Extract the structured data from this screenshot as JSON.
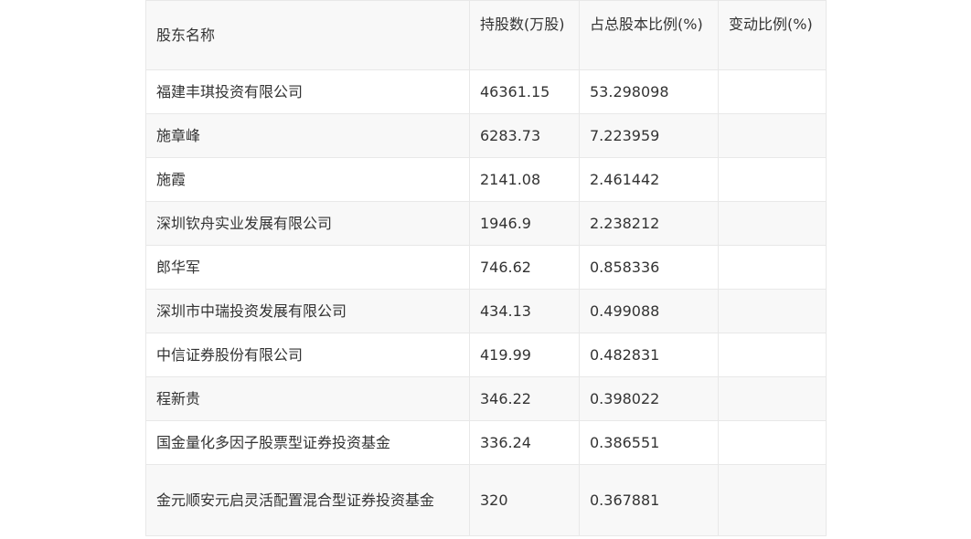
{
  "table": {
    "headers": [
      "股东名称",
      "持股数(万股)",
      "占总股本比例(%)",
      "变动比例(%)"
    ],
    "rows": [
      [
        "福建丰琪投资有限公司",
        "46361.15",
        "53.298098",
        ""
      ],
      [
        "施章峰",
        "6283.73",
        "7.223959",
        ""
      ],
      [
        "施霞",
        "2141.08",
        "2.461442",
        ""
      ],
      [
        "深圳钦舟实业发展有限公司",
        "1946.9",
        "2.238212",
        ""
      ],
      [
        "郎华军",
        "746.62",
        "0.858336",
        ""
      ],
      [
        "深圳市中瑞投资发展有限公司",
        "434.13",
        "0.499088",
        ""
      ],
      [
        "中信证券股份有限公司",
        "419.99",
        "0.482831",
        ""
      ],
      [
        "程新贵",
        "346.22",
        "0.398022",
        ""
      ],
      [
        "国金量化多因子股票型证券投资基金",
        "336.24",
        "0.386551",
        ""
      ],
      [
        "金元顺安元启灵活配置混合型证券投资基金",
        "320",
        "0.367881",
        ""
      ]
    ]
  }
}
